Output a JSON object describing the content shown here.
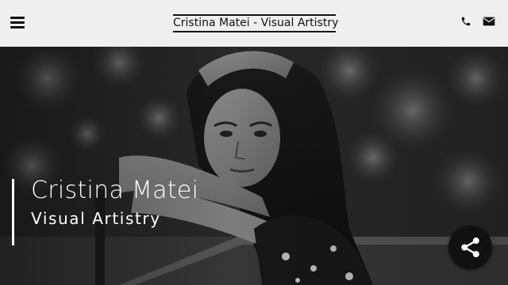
{
  "header": {
    "menu_icon": "hamburger-menu-icon",
    "site_title": "Cristina Matei - Visual Artistry",
    "phone_icon": "phone-icon",
    "mail_icon": "envelope-icon",
    "background_color": "#efefef"
  },
  "hero": {
    "name": "Cristina Matei",
    "subtitle": "Visual Artistry",
    "background_image": "black-and-white-portrait-photo",
    "accent_bar_color": "#ffffff"
  },
  "floating": {
    "share_icon": "share-icon",
    "share_button_color": "#111111"
  }
}
